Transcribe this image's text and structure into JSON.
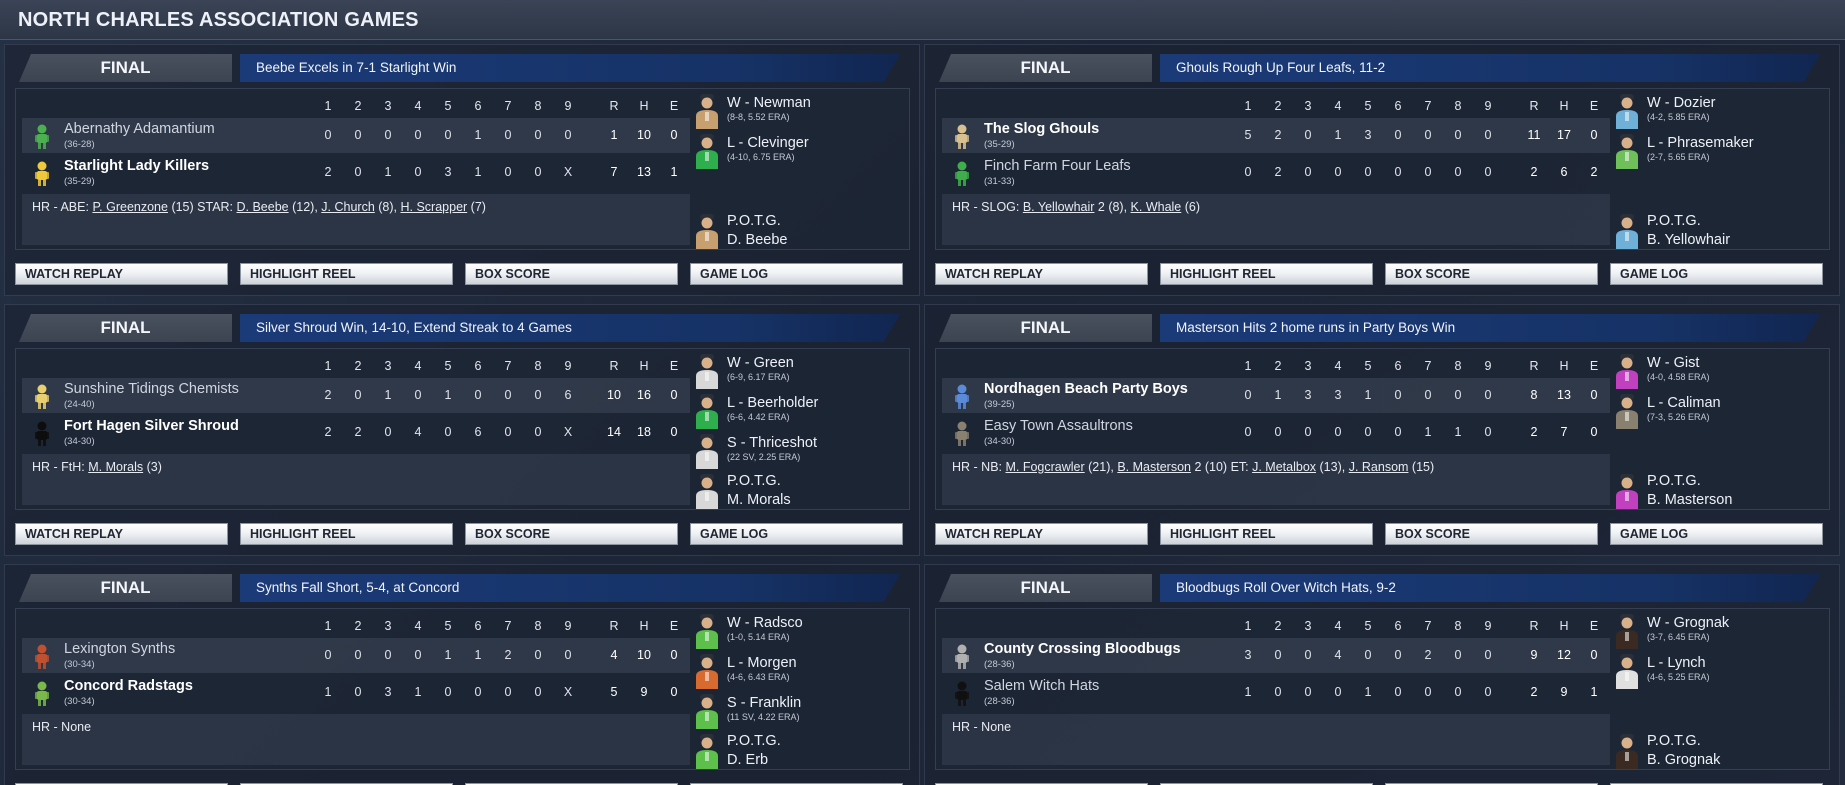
{
  "page_title": "NORTH CHARLES ASSOCIATION GAMES",
  "innings": [
    "1",
    "2",
    "3",
    "4",
    "5",
    "6",
    "7",
    "8",
    "9"
  ],
  "totals_heads": [
    "R",
    "H",
    "E"
  ],
  "buttons": {
    "watch_replay": "WATCH REPLAY",
    "highlight_reel": "HIGHLIGHT REEL",
    "box_score": "BOX SCORE",
    "game_log": "GAME LOG"
  },
  "potg_label": "P.O.T.G.",
  "games": [
    {
      "status": "FINAL",
      "headline": "Beebe Excels in 7-1 Starlight Win",
      "teams": [
        {
          "name": "Abernathy Adamantium",
          "record": "(36-28)",
          "winner": false,
          "icon": "adamantium-icon",
          "icon_color": "#4caf50",
          "line": [
            "0",
            "0",
            "0",
            "0",
            "0",
            "1",
            "0",
            "0",
            "0"
          ],
          "r": "1",
          "h": "10",
          "e": "0"
        },
        {
          "name": "Starlight Lady Killers",
          "record": "(35-29)",
          "winner": true,
          "icon": "lady-killers-icon",
          "icon_color": "#f0c93a",
          "line": [
            "2",
            "0",
            "1",
            "0",
            "3",
            "1",
            "0",
            "0",
            "X"
          ],
          "r": "7",
          "h": "13",
          "e": "1"
        }
      ],
      "hr_segments": [
        {
          "t": "HR - ABE: ",
          "u": false
        },
        {
          "t": "P. Greenzone",
          "u": true
        },
        {
          "t": " (15)  STAR: ",
          "u": false
        },
        {
          "t": "D. Beebe",
          "u": true
        },
        {
          "t": " (12), ",
          "u": false
        },
        {
          "t": "J. Church",
          "u": true
        },
        {
          "t": " (8), ",
          "u": false
        },
        {
          "t": "H. Scrapper",
          "u": true
        },
        {
          "t": " (7)",
          "u": false
        }
      ],
      "pitchers": [
        {
          "name": "W - Newman",
          "stat": "(8-8, 5.52 ERA)",
          "color": "#c8a070"
        },
        {
          "name": "L - Clevinger",
          "stat": "(4-10, 6.75 ERA)",
          "color": "#2fae4e"
        }
      ],
      "potg": {
        "name": "D. Beebe",
        "color": "#c8a070"
      }
    },
    {
      "status": "FINAL",
      "headline": "Ghouls Rough Up Four Leafs, 11-2",
      "teams": [
        {
          "name": "The Slog Ghouls",
          "record": "(35-29)",
          "winner": true,
          "icon": "ghouls-icon",
          "icon_color": "#d8c090",
          "line": [
            "5",
            "2",
            "0",
            "1",
            "3",
            "0",
            "0",
            "0",
            "0"
          ],
          "r": "11",
          "h": "17",
          "e": "0"
        },
        {
          "name": "Finch Farm Four Leafs",
          "record": "(31-33)",
          "winner": false,
          "icon": "four-leafs-icon",
          "icon_color": "#3fae4a",
          "line": [
            "0",
            "2",
            "0",
            "0",
            "0",
            "0",
            "0",
            "0",
            "0"
          ],
          "r": "2",
          "h": "6",
          "e": "2"
        }
      ],
      "hr_segments": [
        {
          "t": "HR - SLOG: ",
          "u": false
        },
        {
          "t": "B. Yellowhair",
          "u": true
        },
        {
          "t": " 2 (8), ",
          "u": false
        },
        {
          "t": "K. Whale",
          "u": true
        },
        {
          "t": " (6)",
          "u": false
        }
      ],
      "pitchers": [
        {
          "name": "W - Dozier",
          "stat": "(4-2, 5.85 ERA)",
          "color": "#6fb0d8"
        },
        {
          "name": "L - Phrasemaker",
          "stat": "(2-7, 5.65 ERA)",
          "color": "#6fbf5a"
        }
      ],
      "potg": {
        "name": "B. Yellowhair",
        "color": "#6fb0d8"
      }
    },
    {
      "status": "FINAL",
      "headline": "Silver Shroud Win, 14-10, Extend Streak to 4 Games",
      "teams": [
        {
          "name": "Sunshine Tidings Chemists",
          "record": "(24-40)",
          "winner": false,
          "icon": "chemists-icon",
          "icon_color": "#e8d070",
          "line": [
            "2",
            "0",
            "1",
            "0",
            "1",
            "0",
            "0",
            "0",
            "6"
          ],
          "r": "10",
          "h": "16",
          "e": "0"
        },
        {
          "name": "Fort Hagen Silver Shroud",
          "record": "(34-30)",
          "winner": true,
          "icon": "silver-shroud-icon",
          "icon_color": "#0d0d0d",
          "line": [
            "2",
            "2",
            "0",
            "4",
            "0",
            "6",
            "0",
            "0",
            "X"
          ],
          "r": "14",
          "h": "18",
          "e": "0"
        }
      ],
      "hr_segments": [
        {
          "t": "HR - FtH: ",
          "u": false
        },
        {
          "t": "M. Morals",
          "u": true
        },
        {
          "t": " (3)",
          "u": false
        }
      ],
      "pitchers": [
        {
          "name": "W - Green",
          "stat": "(6-9, 6.17 ERA)",
          "color": "#d8d8d8"
        },
        {
          "name": "L - Beerholder",
          "stat": "(6-6, 4.42 ERA)",
          "color": "#2fae4e"
        },
        {
          "name": "S - Thriceshot",
          "stat": "(22 SV, 2.25 ERA)",
          "color": "#d8d8d8"
        }
      ],
      "potg": {
        "name": "M. Morals",
        "color": "#d8d8d8"
      }
    },
    {
      "status": "FINAL",
      "headline": "Masterson Hits 2 home runs in Party Boys Win",
      "teams": [
        {
          "name": "Nordhagen Beach Party Boys",
          "record": "(39-25)",
          "winner": true,
          "icon": "party-boys-icon",
          "icon_color": "#5a8ad8",
          "line": [
            "0",
            "1",
            "3",
            "3",
            "1",
            "0",
            "0",
            "0",
            "0"
          ],
          "r": "8",
          "h": "13",
          "e": "0"
        },
        {
          "name": "Easy Town Assaultrons",
          "record": "(34-30)",
          "winner": false,
          "icon": "assaultrons-icon",
          "icon_color": "#8a8070",
          "line": [
            "0",
            "0",
            "0",
            "0",
            "0",
            "0",
            "1",
            "1",
            "0"
          ],
          "r": "2",
          "h": "7",
          "e": "0"
        }
      ],
      "hr_segments": [
        {
          "t": "HR - NB: ",
          "u": false
        },
        {
          "t": "M. Fogcrawler",
          "u": true
        },
        {
          "t": " (21), ",
          "u": false
        },
        {
          "t": "B. Masterson",
          "u": true
        },
        {
          "t": " 2 (10)  ET: ",
          "u": false
        },
        {
          "t": "J. Metalbox",
          "u": true
        },
        {
          "t": " (13), ",
          "u": false
        },
        {
          "t": "J. Ransom",
          "u": true
        },
        {
          "t": " (15)",
          "u": false
        }
      ],
      "pitchers": [
        {
          "name": "W - Gist",
          "stat": "(4-0, 4.58 ERA)",
          "color": "#c040c0"
        },
        {
          "name": "L - Caliman",
          "stat": "(7-3, 5.26 ERA)",
          "color": "#8a8070"
        }
      ],
      "potg": {
        "name": "B. Masterson",
        "color": "#c040c0"
      }
    },
    {
      "status": "FINAL",
      "headline": "Synths Fall Short, 5-4, at Concord",
      "teams": [
        {
          "name": "Lexington Synths",
          "record": "(30-34)",
          "winner": false,
          "icon": "synths-icon",
          "icon_color": "#c05030",
          "line": [
            "0",
            "0",
            "0",
            "0",
            "1",
            "1",
            "2",
            "0",
            "0"
          ],
          "r": "4",
          "h": "10",
          "e": "0"
        },
        {
          "name": "Concord Radstags",
          "record": "(30-34)",
          "winner": true,
          "icon": "radstags-icon",
          "icon_color": "#7ab84a",
          "line": [
            "1",
            "0",
            "3",
            "1",
            "0",
            "0",
            "0",
            "0",
            "X"
          ],
          "r": "5",
          "h": "9",
          "e": "0"
        }
      ],
      "hr_segments": [
        {
          "t": "HR - None",
          "u": false
        }
      ],
      "pitchers": [
        {
          "name": "W - Radsco",
          "stat": "(1-0, 5.14 ERA)",
          "color": "#5cc04a"
        },
        {
          "name": "L - Morgen",
          "stat": "(4-6, 6.43 ERA)",
          "color": "#d86a30"
        },
        {
          "name": "S - Franklin",
          "stat": "(11 SV, 4.22 ERA)",
          "color": "#5cc04a"
        }
      ],
      "potg": {
        "name": "D. Erb",
        "color": "#5cc04a"
      }
    },
    {
      "status": "FINAL",
      "headline": "Bloodbugs Roll Over Witch Hats, 9-2",
      "teams": [
        {
          "name": "County Crossing Bloodbugs",
          "record": "(28-36)",
          "winner": true,
          "icon": "bloodbugs-icon",
          "icon_color": "#b0b0b0",
          "line": [
            "3",
            "0",
            "0",
            "4",
            "0",
            "0",
            "2",
            "0",
            "0"
          ],
          "r": "9",
          "h": "12",
          "e": "0"
        },
        {
          "name": "Salem Witch Hats",
          "record": "(28-36)",
          "winner": false,
          "icon": "witch-hats-icon",
          "icon_color": "#101010",
          "line": [
            "1",
            "0",
            "0",
            "0",
            "1",
            "0",
            "0",
            "0",
            "0"
          ],
          "r": "2",
          "h": "9",
          "e": "1"
        }
      ],
      "hr_segments": [
        {
          "t": "HR - None",
          "u": false
        }
      ],
      "pitchers": [
        {
          "name": "W - Grognak",
          "stat": "(3-7, 6.45 ERA)",
          "color": "#3a2a22"
        },
        {
          "name": "L - Lynch",
          "stat": "(4-6, 5.25 ERA)",
          "color": "#e0e0e0"
        }
      ],
      "potg": {
        "name": "B. Grognak",
        "color": "#3a2a22"
      }
    }
  ]
}
